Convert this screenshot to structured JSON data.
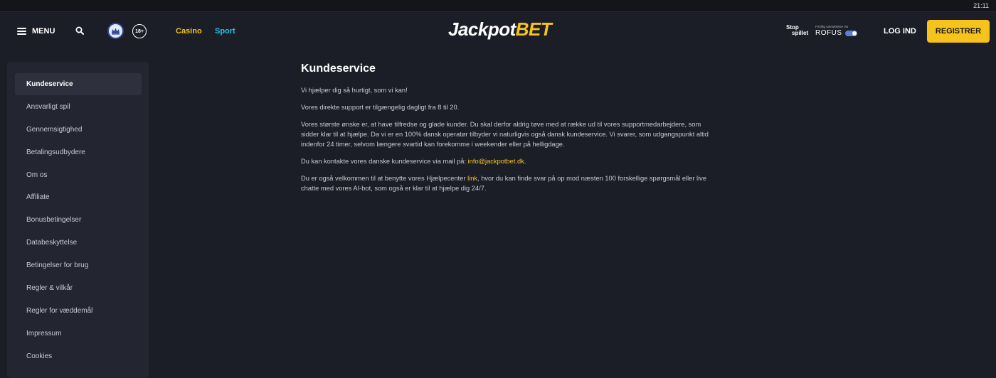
{
  "status_bar": {
    "time": "21:11"
  },
  "header": {
    "menu_label": "MENU",
    "age_badge": "18+",
    "nav": {
      "casino": "Casino",
      "sport": "Sport"
    },
    "logo": {
      "part1": "Jackpot",
      "part2": "BET"
    },
    "stopspillet": {
      "line1": "Stop",
      "line2": "spillet"
    },
    "rofus": {
      "small_text": "Frivillig udelukkelse via",
      "word": "ROFUS"
    },
    "login_label": "LOG IND",
    "register_label": "REGISTRER",
    "icons": [
      "hamburger-icon",
      "search-icon",
      "crown-crest-icon",
      "age-18-icon",
      "toggle-icon"
    ]
  },
  "sidebar": {
    "items": [
      {
        "label": "Kundeservice",
        "active": true
      },
      {
        "label": "Ansvarligt spil"
      },
      {
        "label": "Gennemsigtighed"
      },
      {
        "label": "Betalingsudbydere"
      },
      {
        "label": "Om os"
      },
      {
        "label": "Affiliate"
      },
      {
        "label": "Bonusbetingelser"
      },
      {
        "label": "Databeskyttelse"
      },
      {
        "label": "Betingelser for brug"
      },
      {
        "label": "Regler & vilkår"
      },
      {
        "label": "Regler for væddemål"
      },
      {
        "label": "Impressum"
      },
      {
        "label": "Cookies"
      }
    ]
  },
  "content": {
    "title": "Kundeservice",
    "p1": "Vi hjælper dig så hurtigt, som vi kan!",
    "p2": "Vores direkte support er tilgængelig dagligt fra 8 til 20.",
    "p3": "Vores største ønske er, at have tilfredse og glade kunder. Du skal derfor aldrig tøve med at række ud til vores supportmedarbejdere, som sidder klar til at hjælpe. Da vi er en 100% dansk operatør tilbyder vi naturligvis også dansk kundeservice. Vi svarer, som udgangspunkt altid indenfor 24 timer, selvom længere svartid kan forekomme i weekender eller på helligdage.",
    "p4_prefix": "Du kan kontakte vores danske kundeservice via mail på: ",
    "p4_link": "info@jackpotbet.dk",
    "p4_suffix": ".",
    "p5_prefix": "Du er også velkommen til at benytte vores Hjælpecenter ",
    "p5_link": "link",
    "p5_suffix": ", hvor du kan finde svar på op mod næsten 100 forskellige spørgsmål eller live chatte med vores AI-bot, som også er klar til at hjælpe dig 24/7."
  },
  "colors": {
    "background": "#1c1e27",
    "sidebar_bg": "#232631",
    "accent_yellow": "#f6c21c",
    "accent_cyan": "#2bc0e8",
    "text": "#c8cad2"
  }
}
